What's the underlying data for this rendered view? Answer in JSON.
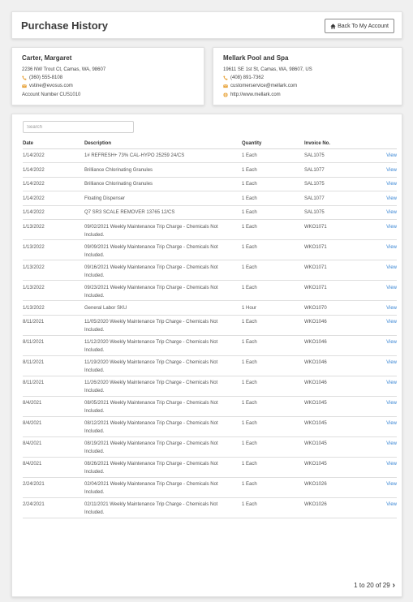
{
  "header": {
    "title": "Purchase History",
    "back_label": "Back To My Account"
  },
  "customer": {
    "name": "Carter, Margaret",
    "address": "2236 NW Trout Ct, Camas, WA, 98607",
    "phone": "(360) 555-8108",
    "email": "vstine@evosus.com",
    "account": "Account Number CUS1010"
  },
  "company": {
    "name": "Mellark Pool and Spa",
    "address": "19611 SE 1st St, Camas, WA, 98607, US",
    "phone": "(408) 891-7362",
    "email": "customerservice@mellark.com",
    "website": "http://www.mellark.com"
  },
  "colors": {
    "accent": "#3a86d4",
    "phone_icon": "#e8a33a",
    "email_icon": "#e8a33a",
    "web_icon": "#e8a33a"
  },
  "search": {
    "placeholder": "Search"
  },
  "table": {
    "headers": {
      "date": "Date",
      "description": "Description",
      "quantity": "Quantity",
      "invoice": "Invoice No."
    },
    "rows": [
      {
        "date": "1/14/2022",
        "description": "1# REFRESH+ 73% CAL-HYPO 25259 24/CS",
        "quantity": "1 Each",
        "invoice": "SAL1075",
        "action": "View"
      },
      {
        "date": "1/14/2022",
        "description": "Brilliance Chlorinating Granules",
        "quantity": "1 Each",
        "invoice": "SAL1077",
        "action": "View"
      },
      {
        "date": "1/14/2022",
        "description": "Brilliance Chlorinating Granules",
        "quantity": "1 Each",
        "invoice": "SAL1075",
        "action": "View"
      },
      {
        "date": "1/14/2022",
        "description": "Floating Dispenser",
        "quantity": "1 Each",
        "invoice": "SAL1077",
        "action": "View"
      },
      {
        "date": "1/14/2022",
        "description": "Q7 SR3 SCALE REMOVER 13765 12/CS",
        "quantity": "1 Each",
        "invoice": "SAL1075",
        "action": "View"
      },
      {
        "date": "1/13/2022",
        "description": "09/02/2021 Weekly Maintenance Trip Charge - Chemicals Not Included.",
        "quantity": "1 Each",
        "invoice": "WKO1071",
        "action": "View"
      },
      {
        "date": "1/13/2022",
        "description": "09/09/2021 Weekly Maintenance Trip Charge - Chemicals Not Included.",
        "quantity": "1 Each",
        "invoice": "WKO1071",
        "action": "View"
      },
      {
        "date": "1/13/2022",
        "description": "09/16/2021 Weekly Maintenance Trip Charge - Chemicals Not Included.",
        "quantity": "1 Each",
        "invoice": "WKO1071",
        "action": "View"
      },
      {
        "date": "1/13/2022",
        "description": "09/23/2021 Weekly Maintenance Trip Charge - Chemicals Not Included.",
        "quantity": "1 Each",
        "invoice": "WKO1071",
        "action": "View"
      },
      {
        "date": "1/13/2022",
        "description": "General Labor SKU",
        "quantity": "1 Hour",
        "invoice": "WKO1070",
        "action": "View"
      },
      {
        "date": "8/11/2021",
        "description": "11/05/2020 Weekly Maintenance Trip Charge - Chemicals Not Included.",
        "quantity": "1 Each",
        "invoice": "WKO1046",
        "action": "View"
      },
      {
        "date": "8/11/2021",
        "description": "11/12/2020 Weekly Maintenance Trip Charge - Chemicals Not Included.",
        "quantity": "1 Each",
        "invoice": "WKO1046",
        "action": "View"
      },
      {
        "date": "8/11/2021",
        "description": "11/19/2020 Weekly Maintenance Trip Charge - Chemicals Not Included.",
        "quantity": "1 Each",
        "invoice": "WKO1046",
        "action": "View"
      },
      {
        "date": "8/11/2021",
        "description": "11/26/2020 Weekly Maintenance Trip Charge - Chemicals Not Included.",
        "quantity": "1 Each",
        "invoice": "WKO1046",
        "action": "View"
      },
      {
        "date": "8/4/2021",
        "description": "08/05/2021 Weekly Maintenance Trip Charge - Chemicals Not Included.",
        "quantity": "1 Each",
        "invoice": "WKO1045",
        "action": "View"
      },
      {
        "date": "8/4/2021",
        "description": "08/12/2021 Weekly Maintenance Trip Charge - Chemicals Not Included.",
        "quantity": "1 Each",
        "invoice": "WKO1045",
        "action": "View"
      },
      {
        "date": "8/4/2021",
        "description": "08/19/2021 Weekly Maintenance Trip Charge - Chemicals Not Included.",
        "quantity": "1 Each",
        "invoice": "WKO1045",
        "action": "View"
      },
      {
        "date": "8/4/2021",
        "description": "08/26/2021 Weekly Maintenance Trip Charge - Chemicals Not Included.",
        "quantity": "1 Each",
        "invoice": "WKO1045",
        "action": "View"
      },
      {
        "date": "2/24/2021",
        "description": "02/04/2021 Weekly Maintenance Trip Charge - Chemicals Not Included.",
        "quantity": "1 Each",
        "invoice": "WKO1026",
        "action": "View"
      },
      {
        "date": "2/24/2021",
        "description": "02/11/2021 Weekly Maintenance Trip Charge - Chemicals Not Included.",
        "quantity": "1 Each",
        "invoice": "WKO1026",
        "action": "View"
      }
    ]
  },
  "pagination": {
    "label": "1 to 20 of 29"
  }
}
